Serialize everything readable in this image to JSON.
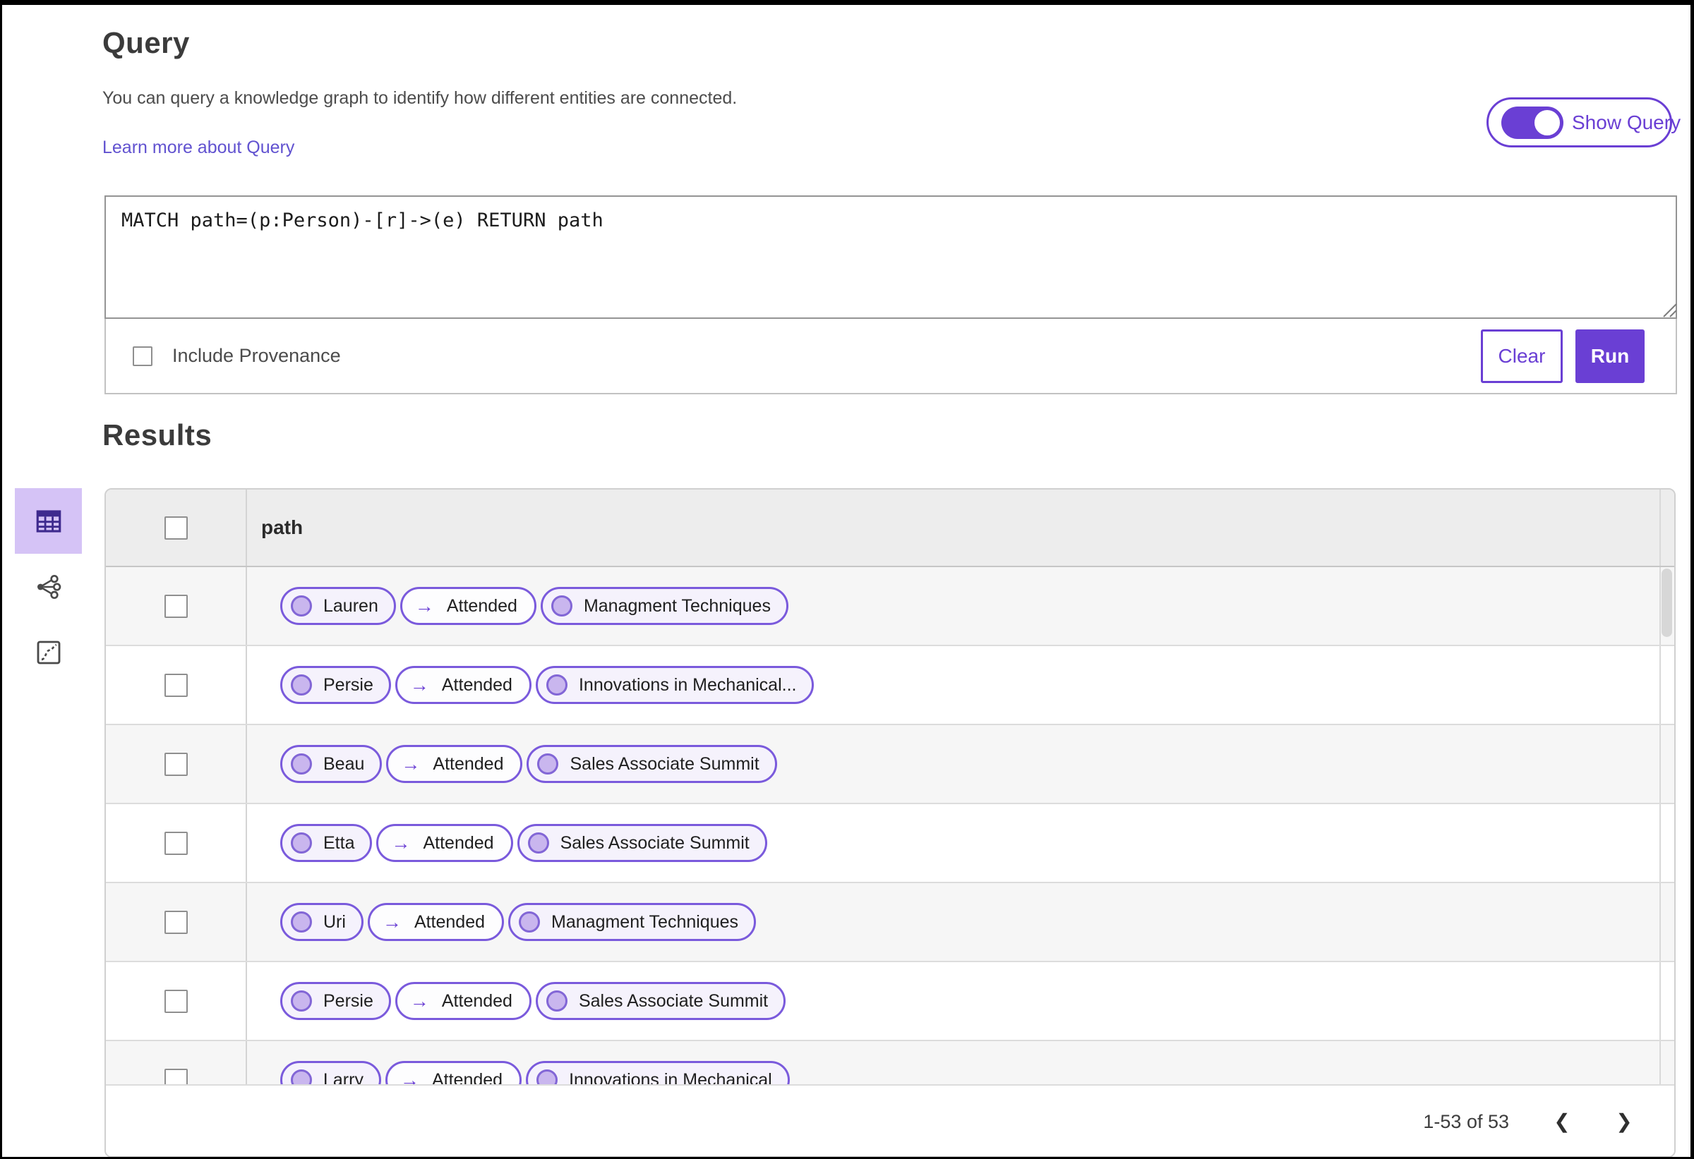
{
  "query_section": {
    "title": "Query",
    "description": "You can query a knowledge graph to identify how different entities are connected.",
    "learn_more_link": "Learn more about Query",
    "show_query_toggle": {
      "label": "Show Query",
      "state": "on"
    },
    "editor": {
      "value": "MATCH path=(p:Person)-[r]->(e) RETURN path"
    },
    "include_provenance": {
      "label": "Include Provenance",
      "checked": false
    },
    "buttons": {
      "clear": "Clear",
      "run": "Run"
    }
  },
  "results_section": {
    "title": "Results",
    "view_switcher": [
      {
        "id": "table-view",
        "icon": "table-icon",
        "selected": true
      },
      {
        "id": "graph-view",
        "icon": "network-icon",
        "selected": false
      },
      {
        "id": "chart-view",
        "icon": "chart-icon",
        "selected": false
      }
    ],
    "table": {
      "header": {
        "column": "path",
        "select_all_checked": false
      },
      "rows": [
        {
          "start_node": "Lauren",
          "relation": "Attended",
          "end_node": "Managment Techniques",
          "selected": false
        },
        {
          "start_node": "Persie",
          "relation": "Attended",
          "end_node": "Innovations in Mechanical...",
          "selected": false
        },
        {
          "start_node": "Beau",
          "relation": "Attended",
          "end_node": "Sales Associate Summit",
          "selected": false
        },
        {
          "start_node": "Etta",
          "relation": "Attended",
          "end_node": "Sales Associate Summit",
          "selected": false
        },
        {
          "start_node": "Uri",
          "relation": "Attended",
          "end_node": "Managment Techniques",
          "selected": false
        },
        {
          "start_node": "Persie",
          "relation": "Attended",
          "end_node": "Sales Associate Summit",
          "selected": false
        },
        {
          "start_node": "Larry",
          "relation": "Attended",
          "end_node": "Innovations in Mechanical",
          "selected": false
        }
      ]
    },
    "pagination": {
      "range_text": "1-53 of 53",
      "prev_icon": "❮",
      "next_icon": "❯"
    }
  },
  "icons": {
    "edge_arrow": "→"
  },
  "colors": {
    "accent": "#6a3fd4",
    "chip_border": "#7a5adc",
    "chip_node_bg": "#f5f2fc",
    "chip_circle_fill": "#c9b6ee",
    "chip_circle_border": "#8266d6",
    "selected_tile_bg": "#d5c3f6",
    "icon_dark": "#3e2a8e",
    "link": "#6152d0"
  }
}
